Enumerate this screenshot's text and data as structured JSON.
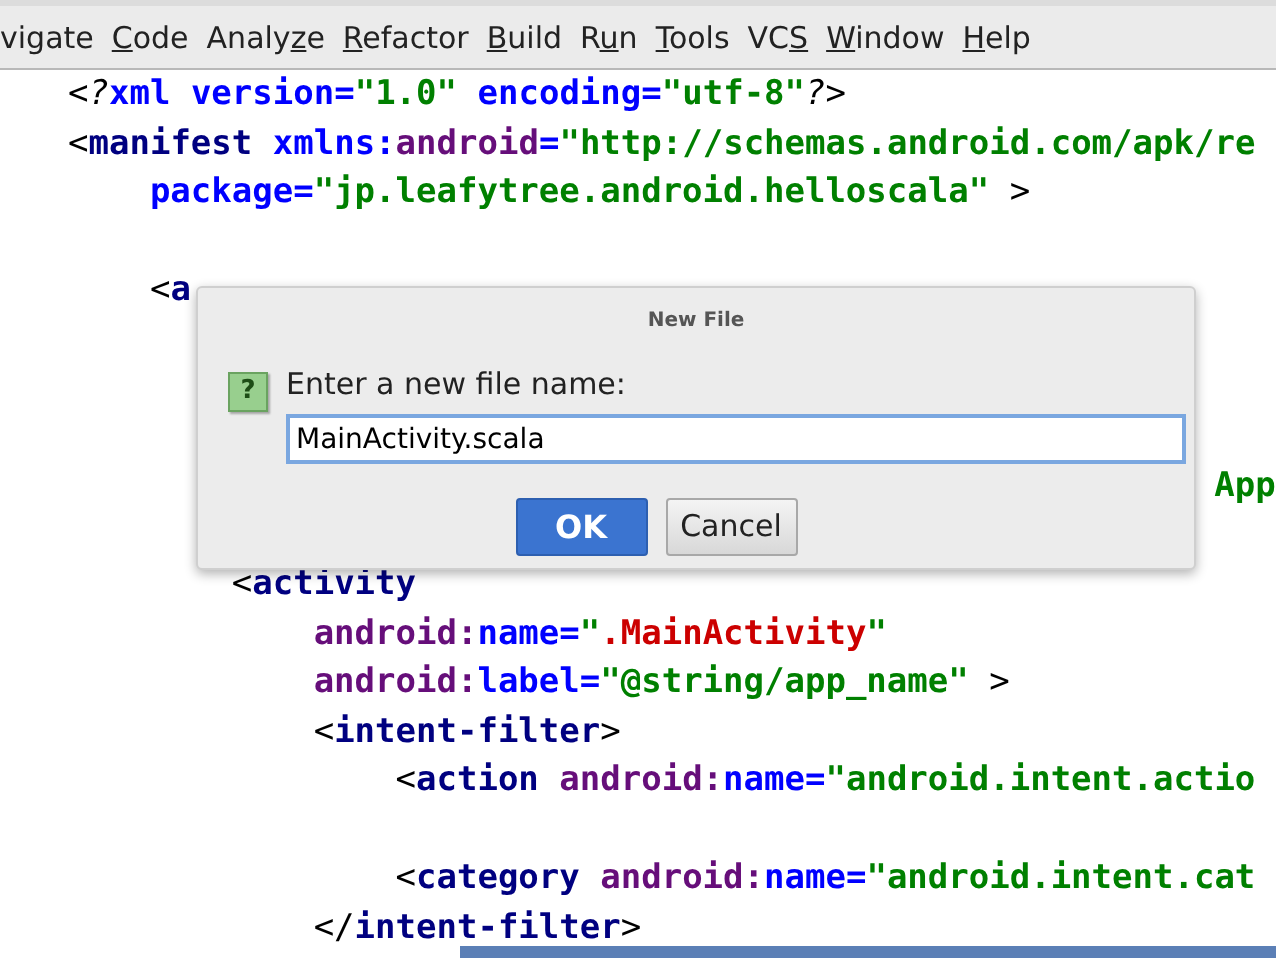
{
  "menu": [
    {
      "pre": "vigate"
    },
    {
      "key": "C",
      "post": "ode"
    },
    {
      "pre": "Analy",
      "key": "z",
      "post": "e"
    },
    {
      "key": "R",
      "post": "efactor"
    },
    {
      "key": "B",
      "post": "uild"
    },
    {
      "pre": "R",
      "key": "u",
      "post": "n"
    },
    {
      "key": "T",
      "post": "ools"
    },
    {
      "pre": "VC",
      "key": "S"
    },
    {
      "key": "W",
      "post": "indow"
    },
    {
      "key": "H",
      "post": "elp"
    }
  ],
  "editor": {
    "lines": [
      {
        "kind": "code",
        "tokens": [
          {
            "kind": "punct",
            "text": "<"
          },
          {
            "kind": "pi",
            "text": "?"
          },
          {
            "kind": "attr",
            "text": "xml version="
          },
          {
            "kind": "value",
            "text": "\"1.0\""
          },
          {
            "kind": "attr",
            "text": " encoding="
          },
          {
            "kind": "value",
            "text": "\"utf-8\""
          },
          {
            "kind": "pi",
            "text": "?"
          },
          {
            "kind": "punct",
            "text": ">"
          }
        ]
      },
      {
        "kind": "code",
        "tokens": [
          {
            "kind": "punct",
            "text": "<"
          },
          {
            "kind": "tag",
            "text": "manifest"
          },
          {
            "kind": "attr",
            "text": " xmlns:"
          },
          {
            "kind": "ns",
            "text": "android"
          },
          {
            "kind": "attr",
            "text": "="
          },
          {
            "kind": "value",
            "text": "\"http://schemas.android.com/apk/re"
          }
        ]
      },
      {
        "kind": "code",
        "tokens": [
          {
            "kind": "attr",
            "text": "    package="
          },
          {
            "kind": "value",
            "text": "\"jp.leafytree.android.helloscala\""
          },
          {
            "kind": "punct",
            "text": " >"
          }
        ]
      },
      {
        "kind": "blank"
      },
      {
        "kind": "code",
        "tokens": [
          {
            "kind": "punct",
            "text": "    <"
          },
          {
            "kind": "tag",
            "text": "a"
          }
        ]
      },
      {
        "kind": "blank"
      },
      {
        "kind": "blank"
      },
      {
        "kind": "blank"
      },
      {
        "kind": "code",
        "tokens": [
          {
            "kind": "value",
            "text": "                                                        App"
          }
        ]
      },
      {
        "kind": "blank"
      },
      {
        "kind": "code",
        "tokens": [
          {
            "kind": "punct",
            "text": "        <"
          },
          {
            "kind": "tag",
            "text": "activity"
          }
        ]
      },
      {
        "kind": "code",
        "tokens": [
          {
            "kind": "ns",
            "text": "            android:"
          },
          {
            "kind": "attr",
            "text": "name="
          },
          {
            "kind": "value",
            "text": "\""
          },
          {
            "kind": "error",
            "text": ".MainActivity"
          },
          {
            "kind": "value",
            "text": "\""
          }
        ]
      },
      {
        "kind": "code",
        "tokens": [
          {
            "kind": "ns",
            "text": "            android:"
          },
          {
            "kind": "attr",
            "text": "label="
          },
          {
            "kind": "value",
            "text": "\"@string/app_name\""
          },
          {
            "kind": "punct",
            "text": " >"
          }
        ]
      },
      {
        "kind": "code",
        "tokens": [
          {
            "kind": "punct",
            "text": "            <"
          },
          {
            "kind": "tag",
            "text": "intent-filter"
          },
          {
            "kind": "punct",
            "text": ">"
          }
        ]
      },
      {
        "kind": "code",
        "tokens": [
          {
            "kind": "punct",
            "text": "                <"
          },
          {
            "kind": "tag",
            "text": "action"
          },
          {
            "kind": "ns",
            "text": " android:"
          },
          {
            "kind": "attr",
            "text": "name="
          },
          {
            "kind": "value",
            "text": "\"android.intent.actio"
          }
        ]
      },
      {
        "kind": "blank"
      },
      {
        "kind": "code",
        "tokens": [
          {
            "kind": "punct",
            "text": "                <"
          },
          {
            "kind": "tag",
            "text": "category"
          },
          {
            "kind": "ns",
            "text": " android:"
          },
          {
            "kind": "attr",
            "text": "name="
          },
          {
            "kind": "value",
            "text": "\"android.intent.cat"
          }
        ]
      },
      {
        "kind": "code",
        "tokens": [
          {
            "kind": "punct",
            "text": "            </"
          },
          {
            "kind": "tag",
            "text": "intent-filter"
          },
          {
            "kind": "punct",
            "text": ">"
          }
        ]
      }
    ]
  },
  "dialog": {
    "title": "New File",
    "prompt": "Enter a new file name:",
    "icon_text": "?",
    "value": "MainActivity.scala",
    "buttons": [
      {
        "label": "OK",
        "default": true
      },
      {
        "label": "Cancel",
        "default": false
      }
    ]
  }
}
